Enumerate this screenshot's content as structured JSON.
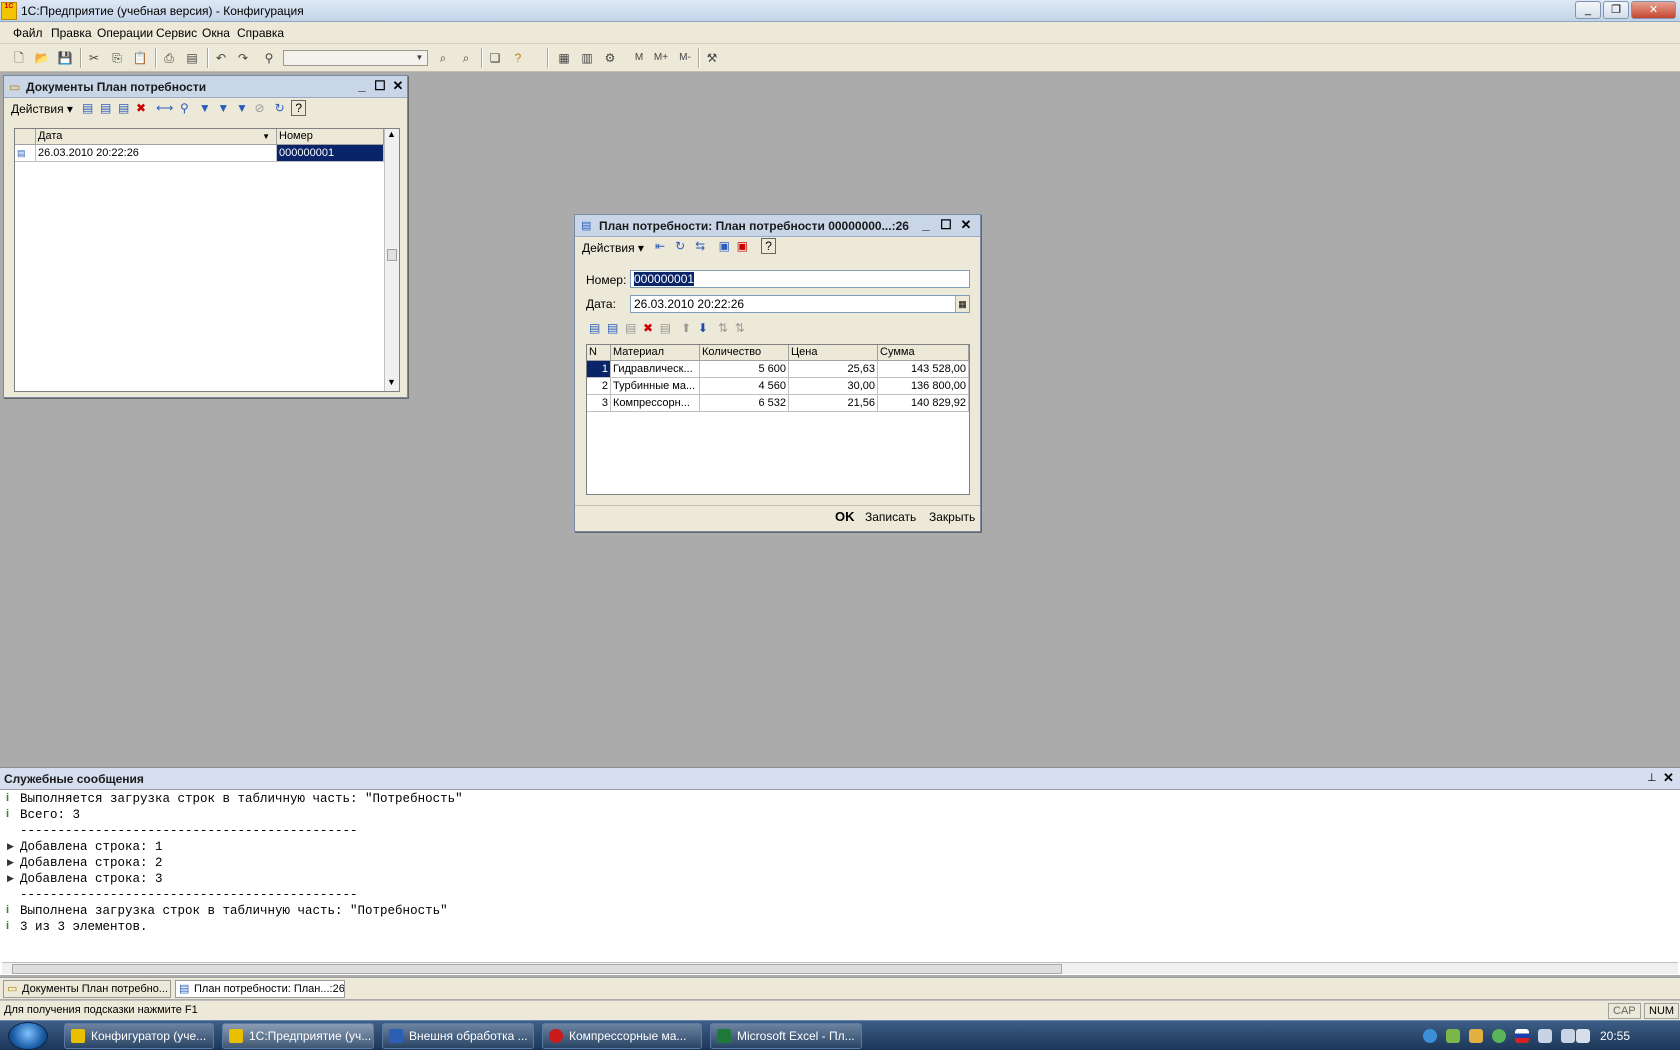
{
  "app": {
    "title": "1С:Предприятие (учебная версия) - Конфигурация",
    "logo_text": "1С"
  },
  "menu": [
    "Файл",
    "Правка",
    "Операции",
    "Сервис",
    "Окна",
    "Справка"
  ],
  "doclist": {
    "title": "Документы План потребности",
    "actions_label": "Действия",
    "columns": [
      "Дата",
      "Номер"
    ],
    "rows": [
      {
        "date": "26.03.2010 20:22:26",
        "number": "000000001"
      }
    ]
  },
  "docform": {
    "title": "План потребности: План потребности 00000000...:26",
    "actions_label": "Действия",
    "number_label": "Номер:",
    "number_value": "000000001",
    "date_label": "Дата:",
    "date_value": "26.03.2010 20:22:26",
    "columns": [
      "N",
      "Материал",
      "Количество",
      "Цена",
      "Сумма"
    ],
    "rows": [
      {
        "n": "1",
        "material": "Гидравлическ...",
        "qty": "5 600",
        "price": "25,63",
        "sum": "143 528,00"
      },
      {
        "n": "2",
        "material": "Турбинные ма...",
        "qty": "4 560",
        "price": "30,00",
        "sum": "136 800,00"
      },
      {
        "n": "3",
        "material": "Компрессорн...",
        "qty": "6 532",
        "price": "21,56",
        "sum": "140 829,92"
      }
    ],
    "buttons": {
      "ok": "OK",
      "save": "Записать",
      "close": "Закрыть"
    }
  },
  "messages": {
    "title": "Служебные сообщения",
    "lines": [
      {
        "icon": "info",
        "text": "Выполняется загрузка строк в табличную часть: \"Потребность\""
      },
      {
        "icon": "info",
        "text": "Всего: 3"
      },
      {
        "icon": "none",
        "text": "---------------------------------------------"
      },
      {
        "icon": "arrow",
        "text": "Добавлена строка: 1"
      },
      {
        "icon": "arrow",
        "text": "Добавлена строка: 2"
      },
      {
        "icon": "arrow",
        "text": "Добавлена строка: 3"
      },
      {
        "icon": "none",
        "text": "---------------------------------------------"
      },
      {
        "icon": "info",
        "text": "Выполнена загрузка строк в табличную часть: \"Потребность\""
      },
      {
        "icon": "info",
        "text": "3 из 3 элементов."
      }
    ]
  },
  "window_tabs": [
    "Документы План потребно...",
    "План потребности: План...:26"
  ],
  "status": {
    "hint": "Для получения подсказки нажмите F1",
    "cap": "CAP",
    "num": "NUM"
  },
  "taskbar": {
    "items": [
      {
        "label": "Конфигуратор (уче...",
        "color": "#e8c000"
      },
      {
        "label": "1С:Предприятие (уч...",
        "color": "#e8c000"
      },
      {
        "label": "Внешня обработка ...",
        "color": "#2b5fb4"
      },
      {
        "label": "Компрессорные ма...",
        "color": "#cc1b1b"
      },
      {
        "label": "Microsoft Excel - Пл...",
        "color": "#1f7a3a"
      }
    ],
    "clock": "20:55"
  }
}
